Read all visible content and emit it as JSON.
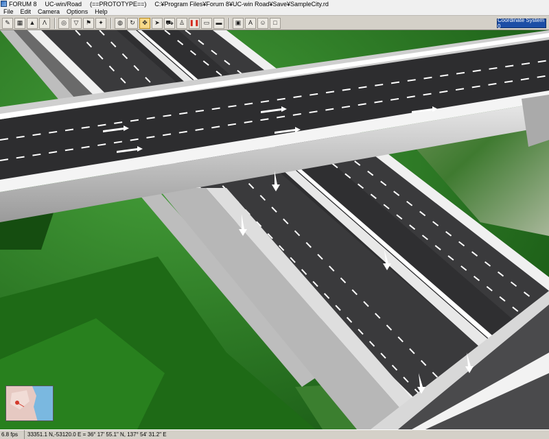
{
  "titlebar": {
    "app_name": "FORUM 8",
    "product": "UC-win/Road",
    "build_tag": "(==PROTOTYPE==)",
    "file_path": "C:¥Program Files¥Forum 8¥UC-win Road¥Save¥SampleCity.rd"
  },
  "menu": {
    "items": [
      {
        "label": "File"
      },
      {
        "label": "Edit"
      },
      {
        "label": "Camera"
      },
      {
        "label": "Options"
      },
      {
        "label": "Help"
      }
    ]
  },
  "toolbar": {
    "coordinate_system": "Coordinate System 0"
  },
  "status": {
    "fps": "6.8 fps",
    "coordinates": "33351.1 N,-53120.0 E = 36° 17' 55.1\" N, 137° 54' 31.2\" E"
  }
}
